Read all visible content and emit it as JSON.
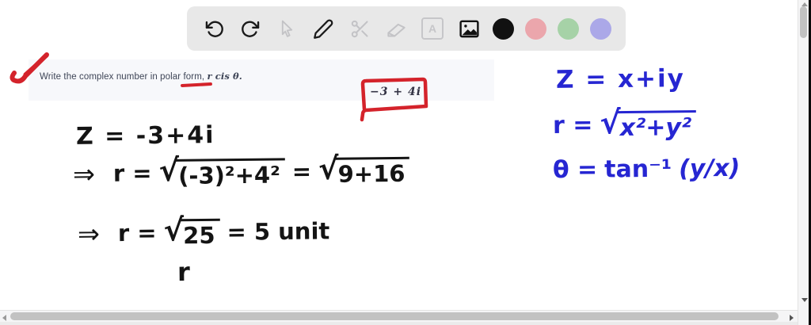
{
  "toolbar": {
    "tools": [
      {
        "name": "undo"
      },
      {
        "name": "redo"
      },
      {
        "name": "cursor"
      },
      {
        "name": "pen"
      },
      {
        "name": "scissors"
      },
      {
        "name": "eraser"
      },
      {
        "name": "text"
      },
      {
        "name": "image"
      }
    ],
    "text_tool_label": "A",
    "colors": [
      {
        "name": "black",
        "hex": "#111111"
      },
      {
        "name": "red",
        "hex": "#eba6ac"
      },
      {
        "name": "green",
        "hex": "#a6d2a7"
      },
      {
        "name": "purple",
        "hex": "#aba8e8"
      }
    ]
  },
  "problem": {
    "statement_prefix": "Write the complex number in polar form, ",
    "statement_math": "r cis θ.",
    "boxed_expression": "−3 + 4i"
  },
  "work": {
    "line1": "Z = -3+4i",
    "line2": {
      "arrow": "⇒",
      "lhs": "r =",
      "sign1": "√",
      "radicand1": "(-3)²+4²",
      "equals": "=",
      "sign2": "√",
      "radicand2": "9+16"
    },
    "line3": {
      "arrow": "⇒",
      "lhs": "r =",
      "sign": "√",
      "radicand": "25",
      "result": "= 5 unit"
    },
    "line4": "r"
  },
  "reference": {
    "line1": "Z = x+iy",
    "line2": {
      "lhs": "r =",
      "sign": "√",
      "radicand": "x²+y²"
    },
    "line3": {
      "lhs": "θ =",
      "fn": "tan⁻¹",
      "arg": "(y/x)"
    }
  },
  "colors": {
    "ink_black": "#141414",
    "ink_blue": "#2626d2",
    "annotation_red": "#d4232b",
    "toolbar_bg": "#e8e8e8",
    "band_bg": "#f7f8fb"
  }
}
